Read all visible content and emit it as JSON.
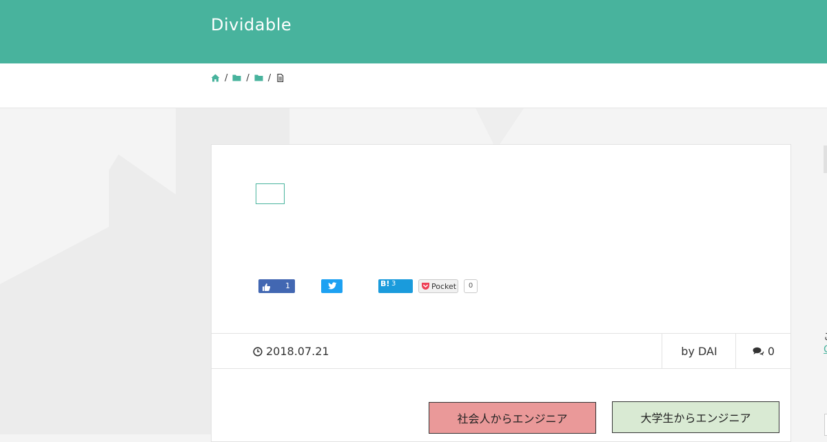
{
  "site": {
    "title": "Dividable"
  },
  "colors": {
    "brand": "#48b39d",
    "facebook": "#4267b2",
    "twitter": "#1da1f2",
    "hatena": "#1a9bdc",
    "tag_a": "#ea9999",
    "tag_b": "#d9ead3"
  },
  "breadcrumb": [
    {
      "icon": "home-icon",
      "sep": "/"
    },
    {
      "icon": "folder-icon",
      "sep": "/"
    },
    {
      "icon": "folder-icon",
      "sep": "/"
    },
    {
      "icon": "file-icon",
      "sep": ""
    }
  ],
  "share": {
    "facebook": {
      "icon": "thumbs-up-icon",
      "count": "1"
    },
    "twitter": {
      "icon": "twitter-bird-icon"
    },
    "hatena": {
      "mark": "B!",
      "count": "3"
    },
    "pocket": {
      "label": "Pocket",
      "count": "0"
    }
  },
  "meta": {
    "date": "2018.07.21",
    "author": "by DAI",
    "comments": "0"
  },
  "tags": [
    "社会人からエンジニア",
    "大学生からエンジニア"
  ],
  "sidebar_edge": {
    "text": "こ",
    "link": "C"
  }
}
